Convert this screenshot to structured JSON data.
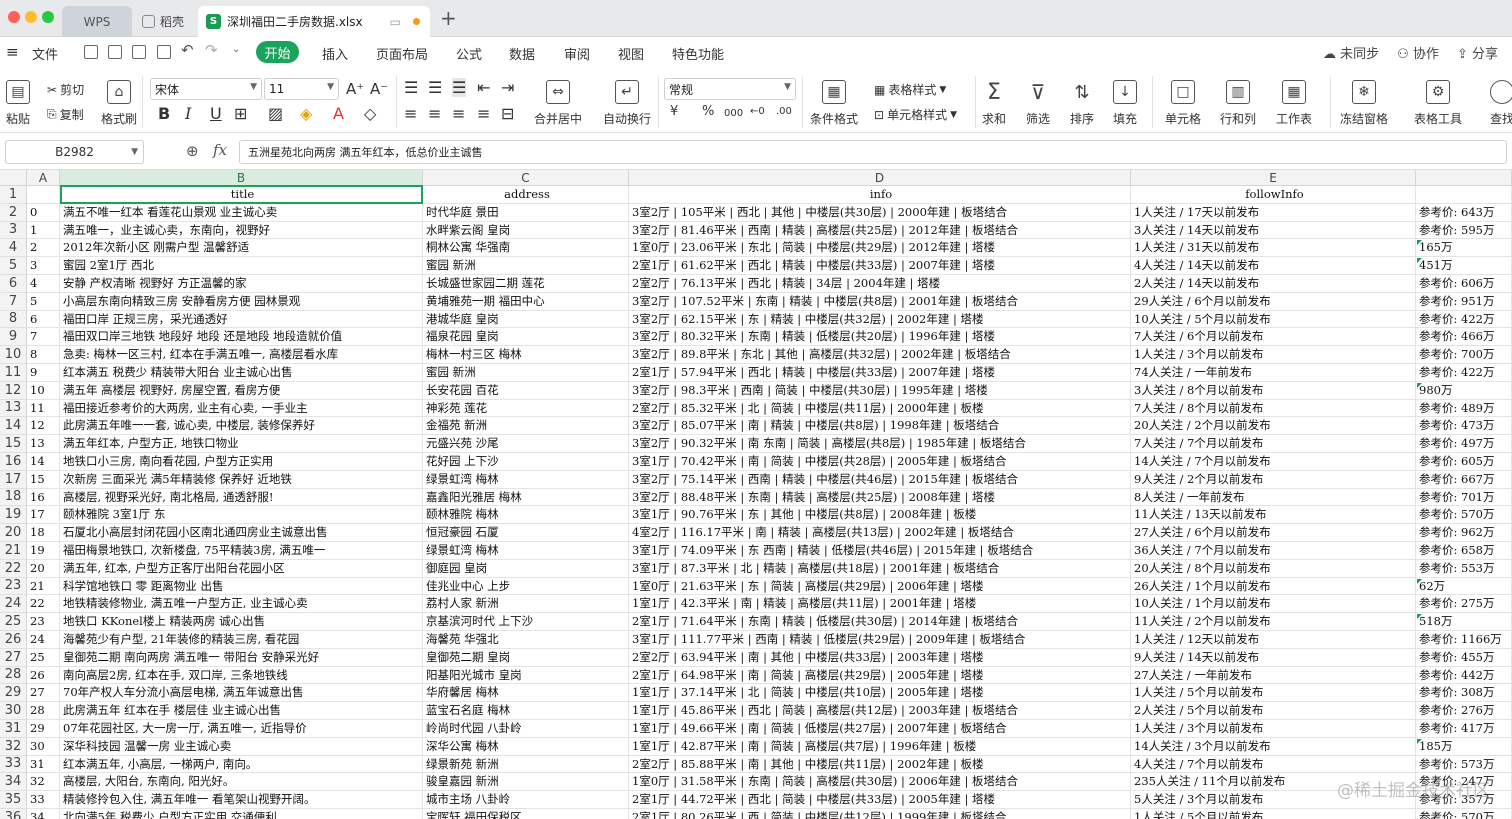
{
  "tabs": {
    "wps": "WPS",
    "daoke": "稻壳",
    "file": "深圳福田二手房数据.xlsx",
    "new": "+"
  },
  "menu": {
    "file": "文件",
    "start": "开始",
    "insert": "插入",
    "layout": "页面布局",
    "formula": "公式",
    "data": "数据",
    "review": "审阅",
    "view": "视图",
    "special": "特色功能",
    "sync": "未同步",
    "collab": "协作",
    "share": "分享"
  },
  "ribbon": {
    "paste": "粘贴",
    "cut": "剪切",
    "copy": "复制",
    "painter": "格式刷",
    "font": "宋体",
    "size": "11",
    "merge": "合并居中",
    "wrap": "自动换行",
    "numfmt": "常规",
    "currency": "¥",
    "percent": "%",
    "thousands": "000",
    "cond": "条件格式",
    "tablestyle": "表格样式",
    "cellstyle": "单元格样式",
    "sum": "求和",
    "filter": "筛选",
    "sort": "排序",
    "fill": "填充",
    "cell": "单元格",
    "rowcol": "行和列",
    "sheet": "工作表",
    "freeze": "冻结窗格",
    "tabletool": "表格工具",
    "find": "查找"
  },
  "namebox": "B2982",
  "formula": "五洲星苑北向两房 满五年红本，低总价业主诚售",
  "columns": [
    "A",
    "B",
    "C",
    "D",
    "E"
  ],
  "header": {
    "a": "",
    "b": "title",
    "c": "address",
    "d": "info",
    "e": "followInfo",
    "f": ""
  },
  "rows": [
    {
      "n": "2",
      "a": "0",
      "b": "满五不唯一红本 看莲花山景观 业主诚心卖",
      "c": "时代华庭 景田",
      "d": "3室2厅 | 105平米 | 西北 | 其他 | 中楼层(共30层) | 2000年建 | 板塔结合",
      "e": "1人关注 / 17天以前发布",
      "f": "参考价: 643万",
      "t": false
    },
    {
      "n": "3",
      "a": "1",
      "b": "满五唯一，业主诚心卖，东南向，视野好",
      "c": "水畔紫云阁 皇岗",
      "d": "3室2厅 | 81.46平米 | 西南 | 精装 | 高楼层(共25层) | 2012年建 | 板塔结合",
      "e": "3人关注 / 14天以前发布",
      "f": "参考价: 595万",
      "t": false
    },
    {
      "n": "4",
      "a": "2",
      "b": "2012年次新小区 刚需户型 温馨舒适",
      "c": "桐林公寓 华强南",
      "d": "1室0厅 | 23.06平米 | 东北 | 简装 | 中楼层(共29层) | 2012年建 | 塔楼",
      "e": "1人关注 / 31天以前发布",
      "f": "165万",
      "t": true
    },
    {
      "n": "5",
      "a": "3",
      "b": "蜜园 2室1厅 西北",
      "c": "蜜园 新洲",
      "d": "2室1厅 | 61.62平米 | 西北 | 精装 | 中楼层(共33层) | 2007年建 | 塔楼",
      "e": "4人关注 / 14天以前发布",
      "f": "451万",
      "t": true
    },
    {
      "n": "6",
      "a": "4",
      "b": "安静 产权清晰 视野好 方正温馨的家",
      "c": "长城盛世家园二期 莲花",
      "d": "2室2厅 | 76.13平米 | 西北 | 精装 | 34层 | 2004年建 | 塔楼",
      "e": "2人关注 / 14天以前发布",
      "f": "参考价: 606万",
      "t": false
    },
    {
      "n": "7",
      "a": "5",
      "b": "小高层东南向精致三房 安静看房方便 园林景观",
      "c": "黄埔雅苑一期 福田中心",
      "d": "3室2厅 | 107.52平米 | 东南 | 精装 | 中楼层(共8层) | 2001年建 | 板塔结合",
      "e": "29人关注 / 6个月以前发布",
      "f": "参考价: 951万",
      "t": false
    },
    {
      "n": "8",
      "a": "6",
      "b": "福田口岸 正规三房，采光通透好",
      "c": "港城华庭 皇岗",
      "d": "3室2厅 | 62.15平米 | 东 | 精装 | 中楼层(共32层) | 2002年建 | 塔楼",
      "e": "10人关注 / 5个月以前发布",
      "f": "参考价: 422万",
      "t": false
    },
    {
      "n": "9",
      "a": "7",
      "b": "福田双口岸三地铁 地段好 地段 还是地段 地段造就价值",
      "c": "福泉花园 皇岗",
      "d": "3室2厅 | 80.32平米 | 东南 | 精装 | 低楼层(共20层) | 1996年建 | 塔楼",
      "e": "7人关注 / 6个月以前发布",
      "f": "参考价: 466万",
      "t": false
    },
    {
      "n": "10",
      "a": "8",
      "b": "急卖: 梅林一区三村, 红本在手满五唯一, 高楼层看水库",
      "c": "梅林一村三区 梅林",
      "d": "3室2厅 | 89.8平米 | 东北 | 其他 | 高楼层(共32层) | 2002年建 | 板塔结合",
      "e": "1人关注 / 3个月以前发布",
      "f": "参考价: 700万",
      "t": false
    },
    {
      "n": "11",
      "a": "9",
      "b": "红本满五 税费少 精装带大阳台 业主诚心出售",
      "c": "蜜园 新洲",
      "d": "2室1厅 | 57.94平米 | 西北 | 精装 | 中楼层(共33层) | 2007年建 | 塔楼",
      "e": "74人关注 / 一年前发布",
      "f": "参考价: 422万",
      "t": false
    },
    {
      "n": "12",
      "a": "10",
      "b": "满五年 高楼层 视野好, 房屋空置, 看房方便",
      "c": "长安花园 百花",
      "d": "3室2厅 | 98.3平米 | 西南 | 简装 | 中楼层(共30层) | 1995年建 | 塔楼",
      "e": "3人关注 / 8个月以前发布",
      "f": "980万",
      "t": true
    },
    {
      "n": "13",
      "a": "11",
      "b": "福田接近参考价的大两房, 业主有心卖, 一手业主",
      "c": "神彩苑 莲花",
      "d": "2室2厅 | 85.32平米 | 北 | 简装 | 中楼层(共11层) | 2000年建 | 板楼",
      "e": "7人关注 / 8个月以前发布",
      "f": "参考价: 489万",
      "t": false
    },
    {
      "n": "14",
      "a": "12",
      "b": "此房满五年唯一一套, 诚心卖, 中楼层, 装修保养好",
      "c": "金福苑 新洲",
      "d": "3室2厅 | 85.07平米 | 南 | 精装 | 中楼层(共8层) | 1998年建 | 板塔结合",
      "e": "20人关注 / 2个月以前发布",
      "f": "参考价: 473万",
      "t": false
    },
    {
      "n": "15",
      "a": "13",
      "b": "满五年红本, 户型方正, 地铁口物业",
      "c": "元盛兴苑 沙尾",
      "d": "3室2厅 | 90.32平米 | 南 东南 | 简装 | 高楼层(共8层) | 1985年建 | 板塔结合",
      "e": "7人关注 / 7个月以前发布",
      "f": "参考价: 497万",
      "t": false
    },
    {
      "n": "16",
      "a": "14",
      "b": "地铁口小三房, 南向看花园, 户型方正实用",
      "c": "花好园 上下沙",
      "d": "3室1厅 | 70.42平米 | 南 | 简装 | 中楼层(共28层) | 2005年建 | 板塔结合",
      "e": "14人关注 / 7个月以前发布",
      "f": "参考价: 605万",
      "t": false
    },
    {
      "n": "17",
      "a": "15",
      "b": "次新房 三面采光 满5年精装修 保养好 近地铁",
      "c": "绿景虹湾 梅林",
      "d": "3室2厅 | 75.14平米 | 西南 | 精装 | 中楼层(共46层) | 2015年建 | 板塔结合",
      "e": "9人关注 / 2个月以前发布",
      "f": "参考价: 667万",
      "t": false
    },
    {
      "n": "18",
      "a": "16",
      "b": "高楼层, 视野采光好, 南北格局, 通透舒服!",
      "c": "嘉鑫阳光雅居 梅林",
      "d": "3室2厅 | 88.48平米 | 东南 | 精装 | 高楼层(共25层) | 2008年建 | 塔楼",
      "e": "8人关注 / 一年前发布",
      "f": "参考价: 701万",
      "t": false
    },
    {
      "n": "19",
      "a": "17",
      "b": "颐林雅院 3室1厅 东",
      "c": "颐林雅院 梅林",
      "d": "3室1厅 | 90.76平米 | 东 | 其他 | 中楼层(共8层) | 2008年建 | 板楼",
      "e": "11人关注 / 13天以前发布",
      "f": "参考价: 570万",
      "t": false
    },
    {
      "n": "20",
      "a": "18",
      "b": "石厦北小高层封闭花园小区南北通四房业主诚意出售",
      "c": "恒冠豪园 石厦",
      "d": "4室2厅 | 116.17平米 | 南 | 精装 | 高楼层(共13层) | 2002年建 | 板塔结合",
      "e": "27人关注 / 6个月以前发布",
      "f": "参考价: 962万",
      "t": false
    },
    {
      "n": "21",
      "a": "19",
      "b": "福田梅景地铁口, 次新楼盘, 75平精装3房, 满五唯一",
      "c": "绿景虹湾 梅林",
      "d": "3室1厅 | 74.09平米 | 东 西南 | 精装 | 低楼层(共46层) | 2015年建 | 板塔结合",
      "e": "36人关注 / 7个月以前发布",
      "f": "参考价: 658万",
      "t": false
    },
    {
      "n": "22",
      "a": "20",
      "b": "满五年, 红本, 户型方正客厅出阳台花园小区",
      "c": "御庭园 皇岗",
      "d": "3室1厅 | 87.3平米 | 北 | 精装 | 高楼层(共18层) | 2001年建 | 板塔结合",
      "e": "20人关注 / 8个月以前发布",
      "f": "参考价: 553万",
      "t": false
    },
    {
      "n": "23",
      "a": "21",
      "b": "科学馆地铁口 零 距离物业 出售",
      "c": "佳兆业中心 上步",
      "d": "1室0厅 | 21.63平米 | 东 | 简装 | 高楼层(共29层) | 2006年建 | 塔楼",
      "e": "26人关注 / 1个月以前发布",
      "f": "62万",
      "t": true
    },
    {
      "n": "24",
      "a": "22",
      "b": "地铁精装修物业, 满五唯一户型方正, 业主诚心卖",
      "c": "荔村人家 新洲",
      "d": "1室1厅 | 42.3平米 | 南 | 精装 | 高楼层(共11层) | 2001年建 | 塔楼",
      "e": "10人关注 / 1个月以前发布",
      "f": "参考价: 275万",
      "t": false
    },
    {
      "n": "25",
      "a": "23",
      "b": "地铁口 KKonel楼上 精装两房 诚心出售",
      "c": "京基滨河时代 上下沙",
      "d": "2室1厅 | 71.64平米 | 东南 | 精装 | 低楼层(共30层) | 2014年建 | 板塔结合",
      "e": "11人关注 / 2个月以前发布",
      "f": "518万",
      "t": true
    },
    {
      "n": "26",
      "a": "24",
      "b": "海馨苑少有户型, 21年装修的精装三房, 看花园",
      "c": "海馨苑 华强北",
      "d": "3室1厅 | 111.77平米 | 西南 | 精装 | 低楼层(共29层) | 2009年建 | 板塔结合",
      "e": "1人关注 / 12天以前发布",
      "f": "参考价: 1166万",
      "t": false
    },
    {
      "n": "27",
      "a": "25",
      "b": "皇御苑二期 南向两房 满五唯一 带阳台 安静采光好",
      "c": "皇御苑二期 皇岗",
      "d": "2室2厅 | 63.94平米 | 南 | 其他 | 中楼层(共33层) | 2003年建 | 塔楼",
      "e": "9人关注 / 14天以前发布",
      "f": "参考价: 455万",
      "t": false
    },
    {
      "n": "28",
      "a": "26",
      "b": "南向高层2房, 红本在手, 双口岸, 三条地铁线",
      "c": "阳基阳光城市 皇岗",
      "d": "2室1厅 | 64.98平米 | 南 | 简装 | 高楼层(共29层) | 2005年建 | 塔楼",
      "e": "27人关注 / 一年前发布",
      "f": "参考价: 442万",
      "t": false
    },
    {
      "n": "29",
      "a": "27",
      "b": "70年产权人车分流小高层电梯, 满五年诚意出售",
      "c": "华府馨居 梅林",
      "d": "1室1厅 | 37.14平米 | 北 | 简装 | 中楼层(共10层) | 2005年建 | 塔楼",
      "e": "1人关注 / 5个月以前发布",
      "f": "参考价: 308万",
      "t": false
    },
    {
      "n": "30",
      "a": "28",
      "b": "此房满五年 红本在手 楼层佳 业主诚心出售",
      "c": "蓝宝石名庭 梅林",
      "d": "1室1厅 | 45.86平米 | 西北 | 简装 | 高楼层(共12层) | 2003年建 | 板塔结合",
      "e": "2人关注 / 5个月以前发布",
      "f": "参考价: 276万",
      "t": false
    },
    {
      "n": "31",
      "a": "29",
      "b": "07年花园社区, 大一房一厅, 满五唯一, 近指导价",
      "c": "岭尚时代园 八卦岭",
      "d": "1室1厅 | 49.66平米 | 南 | 简装 | 低楼层(共27层) | 2007年建 | 板塔结合",
      "e": "1人关注 / 3个月以前发布",
      "f": "参考价: 417万",
      "t": false
    },
    {
      "n": "32",
      "a": "30",
      "b": "深华科技园 温馨一房 业主诚心卖",
      "c": "深华公寓 梅林",
      "d": "1室1厅 | 42.87平米 | 南 | 简装 | 高楼层(共7层) | 1996年建 | 板楼",
      "e": "14人关注 / 3个月以前发布",
      "f": "185万",
      "t": true
    },
    {
      "n": "33",
      "a": "31",
      "b": "红本满五年, 小高层, 一梯两户, 南向。",
      "c": "绿景新苑 新洲",
      "d": "2室2厅 | 85.88平米 | 南 | 其他 | 中楼层(共11层) | 2002年建 | 板楼",
      "e": "4人关注 / 7个月以前发布",
      "f": "参考价: 573万",
      "t": false
    },
    {
      "n": "34",
      "a": "32",
      "b": "高楼层, 大阳台, 东南向, 阳光好。",
      "c": "骏皇嘉园 新洲",
      "d": "1室0厅 | 31.58平米 | 东南 | 简装 | 高楼层(共30层) | 2006年建 | 板塔结合",
      "e": "235人关注 / 11个月以前发布",
      "f": "参考价: 247万",
      "t": false
    },
    {
      "n": "35",
      "a": "33",
      "b": "精装修拎包入住, 满五年唯一 看笔架山视野开阔。",
      "c": "城市主场 八卦岭",
      "d": "2室1厅 | 44.72平米 | 西北 | 简装 | 中楼层(共33层) | 2005年建 | 塔楼",
      "e": "5人关注 / 3个月以前发布",
      "f": "参考价: 357万",
      "t": false
    },
    {
      "n": "36",
      "a": "34",
      "b": "北向满5年 税费少 户型方正实用 交通便利",
      "c": "宝晖轩 福田保税区",
      "d": "2室1厅 | 80.26平米 | 西 | 简装 | 中楼层(共12层) | 1999年建 | 板塔结合",
      "e": "1人关注 / 5个月以前发布",
      "f": "参考价: 570万",
      "t": false
    }
  ],
  "watermark": "@稀土掘金技术社区"
}
